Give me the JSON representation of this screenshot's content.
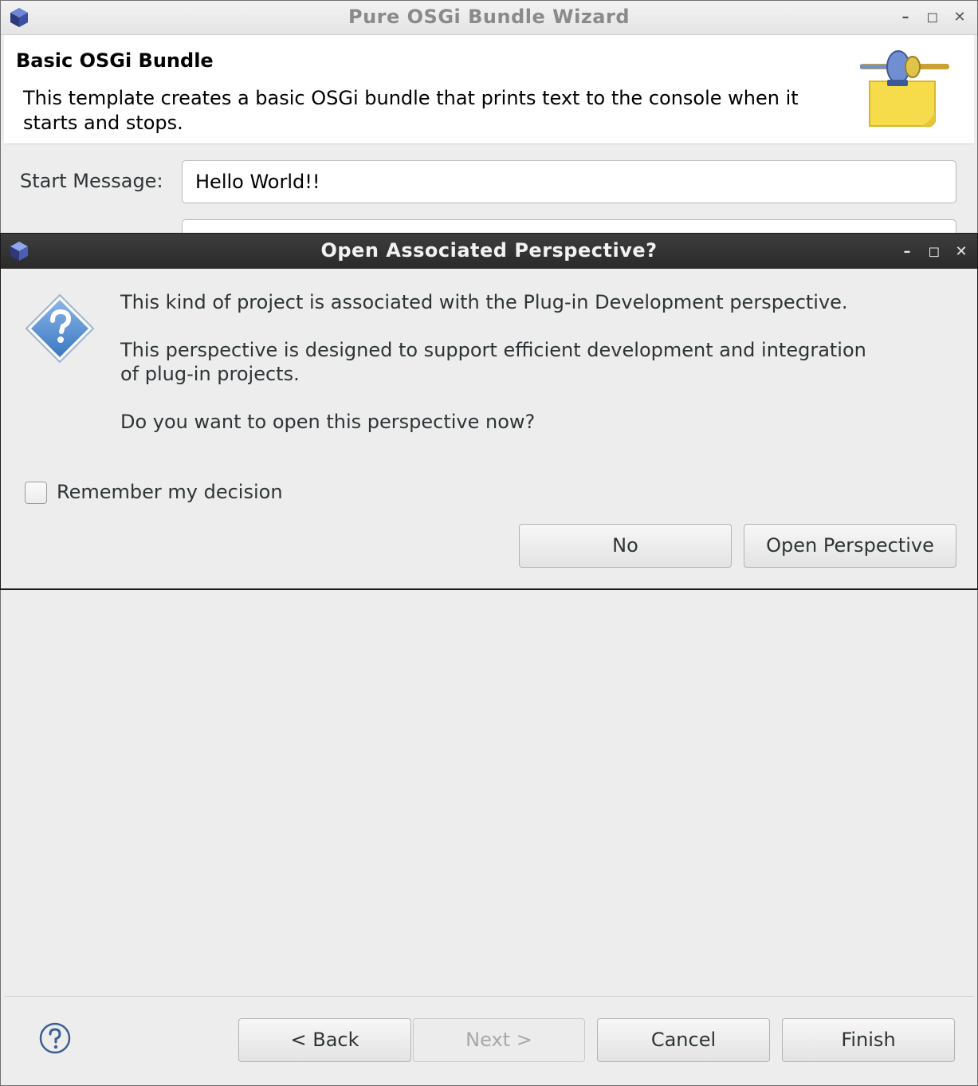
{
  "wizard": {
    "title": "Pure OSGi Bundle Wizard",
    "banner": {
      "title": "Basic OSGi Bundle",
      "description": "This template creates a basic OSGi bundle that prints text to the console when it starts and stops."
    },
    "start_message": {
      "label": "Start Message:",
      "value": "Hello World!!"
    },
    "buttons": {
      "back": "< Back",
      "next": "Next >",
      "cancel": "Cancel",
      "finish": "Finish"
    },
    "window_controls": {
      "minimize": "–",
      "maximize": "◻",
      "close": "✕"
    }
  },
  "dialog": {
    "title": "Open Associated Perspective?",
    "line1": "This kind of project is associated with the Plug-in Development perspective.",
    "line2": "This perspective is designed to support efficient development and integration",
    "line3": "of plug-in projects.",
    "line4": "Do you want to open this perspective now?",
    "remember_label": "Remember my decision",
    "remember_checked": false,
    "buttons": {
      "no": "No",
      "open": "Open Perspective"
    },
    "window_controls": {
      "minimize": "–",
      "maximize": "◻",
      "close": "✕"
    }
  },
  "colors": {
    "dialog_titlebar": "#2f2f2f",
    "question_icon": "#4a86c8"
  }
}
